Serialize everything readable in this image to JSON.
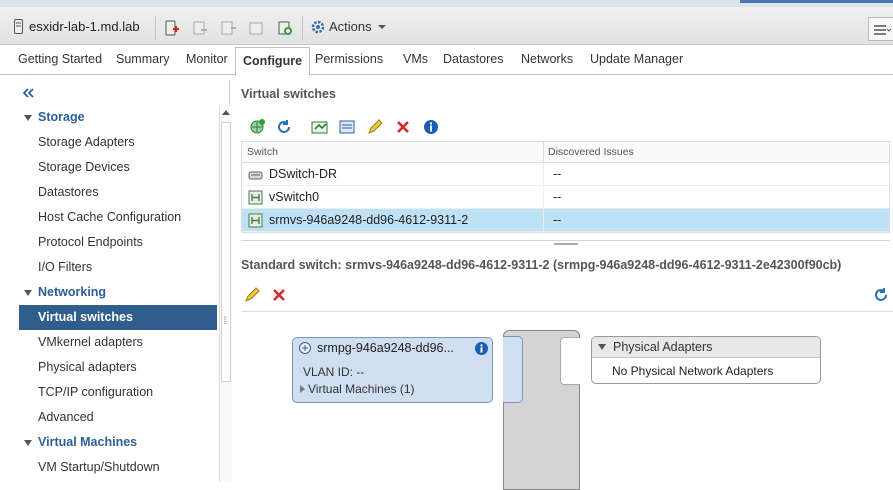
{
  "header": {
    "host_name": "esxidr-lab-1.md.lab",
    "actions_label": "Actions"
  },
  "tabs": [
    {
      "label": "Getting Started"
    },
    {
      "label": "Summary"
    },
    {
      "label": "Monitor"
    },
    {
      "label": "Configure",
      "active": true
    },
    {
      "label": "Permissions"
    },
    {
      "label": "VMs"
    },
    {
      "label": "Datastores"
    },
    {
      "label": "Networks"
    },
    {
      "label": "Update Manager"
    }
  ],
  "sidebar": {
    "items": [
      {
        "label": "Storage",
        "group": true
      },
      {
        "label": "Storage Adapters"
      },
      {
        "label": "Storage Devices"
      },
      {
        "label": "Datastores"
      },
      {
        "label": "Host Cache Configuration"
      },
      {
        "label": "Protocol Endpoints"
      },
      {
        "label": "I/O Filters"
      },
      {
        "label": "Networking",
        "group": true
      },
      {
        "label": "Virtual switches",
        "selected": true
      },
      {
        "label": "VMkernel adapters"
      },
      {
        "label": "Physical adapters"
      },
      {
        "label": "TCP/IP configuration"
      },
      {
        "label": "Advanced"
      },
      {
        "label": "Virtual Machines",
        "group": true
      },
      {
        "label": "VM Startup/Shutdown"
      }
    ]
  },
  "virtual_switches": {
    "title": "Virtual switches",
    "columns": [
      "Switch",
      "Discovered Issues"
    ],
    "rows": [
      {
        "name": "DSwitch-DR",
        "issues": "--",
        "icon": "distributed-switch-icon"
      },
      {
        "name": "vSwitch0",
        "issues": "--",
        "icon": "standard-switch-icon"
      },
      {
        "name": "srmvs-946a9248-dd96-4612-9311-2",
        "issues": "--",
        "icon": "standard-switch-icon",
        "selected": true
      }
    ]
  },
  "standard_switch": {
    "title": "Standard switch: srmvs-946a9248-dd96-4612-9311-2 (srmpg-946a9248-dd96-4612-9311-2e42300f90cb)",
    "port_group": {
      "name": "srmpg-946a9248-dd96...",
      "vlan": "VLAN ID: --",
      "vms": "Virtual Machines (1)"
    },
    "physical_adapters": {
      "title": "Physical Adapters",
      "empty_text": "No Physical Network Adapters"
    }
  },
  "colors": {
    "accent": "#2f5d8c",
    "nav_group": "#2d5f96",
    "selection": "#bfe1f5",
    "portgroup_fill": "#cfdef0",
    "delete_red": "#d42a2a",
    "edit_yellow": "#c8a31a"
  }
}
